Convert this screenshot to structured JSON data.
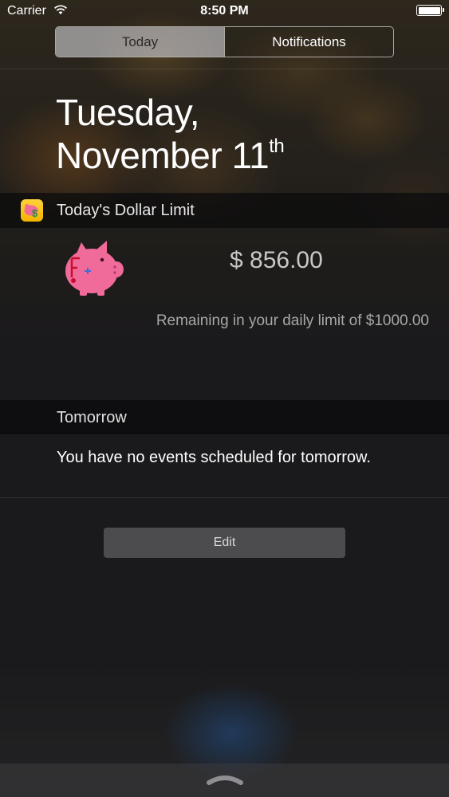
{
  "status_bar": {
    "carrier": "Carrier",
    "time": "8:50 PM",
    "wifi_icon": "wifi-icon",
    "battery_icon": "battery-icon"
  },
  "segmented": {
    "tabs": [
      {
        "label": "Today",
        "selected": true
      },
      {
        "label": "Notifications",
        "selected": false
      }
    ]
  },
  "date": {
    "line1": "Tuesday,",
    "line2": "November 11",
    "suffix": "th"
  },
  "widget": {
    "app_icon": "piggy-bank-dollar-icon",
    "title": "Today's Dollar Limit",
    "image": "piggy-bank-icon",
    "amount": "$ 856.00",
    "remaining_text": "Remaining in your daily limit of $1000.00"
  },
  "tomorrow": {
    "title": "Tomorrow",
    "message": "You have no events scheduled for tomorrow."
  },
  "edit_button": {
    "label": "Edit"
  },
  "bottom": {
    "grabber_icon": "chevron-up-grabber-icon"
  },
  "colors": {
    "background": "#1c1c1f",
    "pig_pink": "#f06a9a",
    "app_icon_yellow": "#f4b400",
    "edit_button": "#4c4c4e"
  }
}
